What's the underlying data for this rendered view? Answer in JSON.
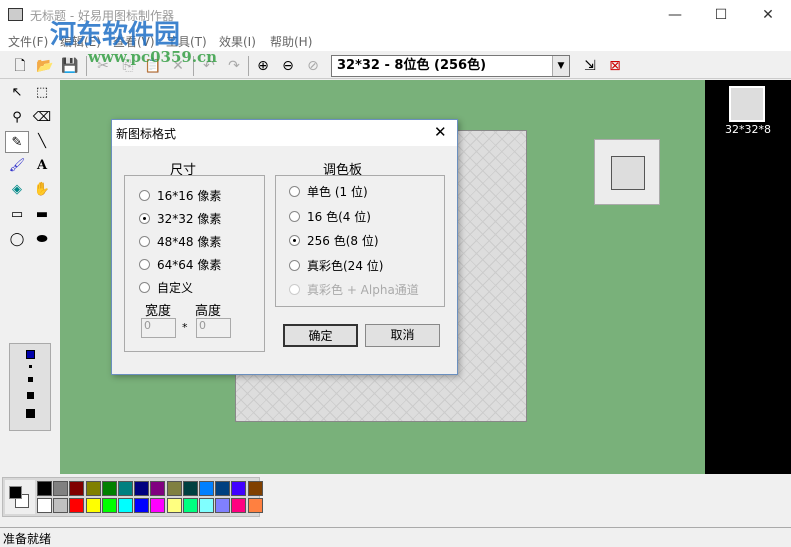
{
  "window": {
    "title": "无标题 - 好易用图标制作器",
    "minimize": "—",
    "maximize": "☐",
    "close": "✕"
  },
  "menu": [
    "文件(F)",
    "编辑(E)",
    "查看(V)",
    "工具(T)",
    "效果(I)",
    "帮助(H)"
  ],
  "watermark": {
    "name": "河东软件园",
    "url": "www.pc0359.cn"
  },
  "toolbar": {
    "format_combo": "32*32 - 8位色 (256色)"
  },
  "preview": {
    "label": "32*32*8"
  },
  "dialog": {
    "title": "新图标格式",
    "size_group": "尺寸",
    "sizes": [
      "16*16 像素",
      "32*32 像素",
      "48*48 像素",
      "64*64 像素",
      "自定义"
    ],
    "size_selected": 1,
    "width_label": "宽度",
    "height_label": "高度",
    "width_value": "0",
    "height_value": "0",
    "times": "*",
    "palette_group": "调色板",
    "palettes": [
      "单色 (1 位)",
      "16 色(4 位)",
      "256 色(8 位)",
      "真彩色(24 位)",
      "真彩色 + Alpha通道"
    ],
    "palette_selected": 2,
    "palette_disabled": 4,
    "ok": "确定",
    "cancel": "取消"
  },
  "palette_colors": {
    "top": [
      "#000000",
      "#808080",
      "#800000",
      "#808000",
      "#008000",
      "#008080",
      "#000080",
      "#800080",
      "#808040",
      "#004040",
      "#0080ff",
      "#004080",
      "#4000ff",
      "#804000"
    ],
    "bottom": [
      "#ffffff",
      "#c0c0c0",
      "#ff0000",
      "#ffff00",
      "#00ff00",
      "#00ffff",
      "#0000ff",
      "#ff00ff",
      "#ffff80",
      "#00ff80",
      "#80ffff",
      "#8080ff",
      "#ff0080",
      "#ff8040"
    ]
  },
  "status": "准备就绪"
}
